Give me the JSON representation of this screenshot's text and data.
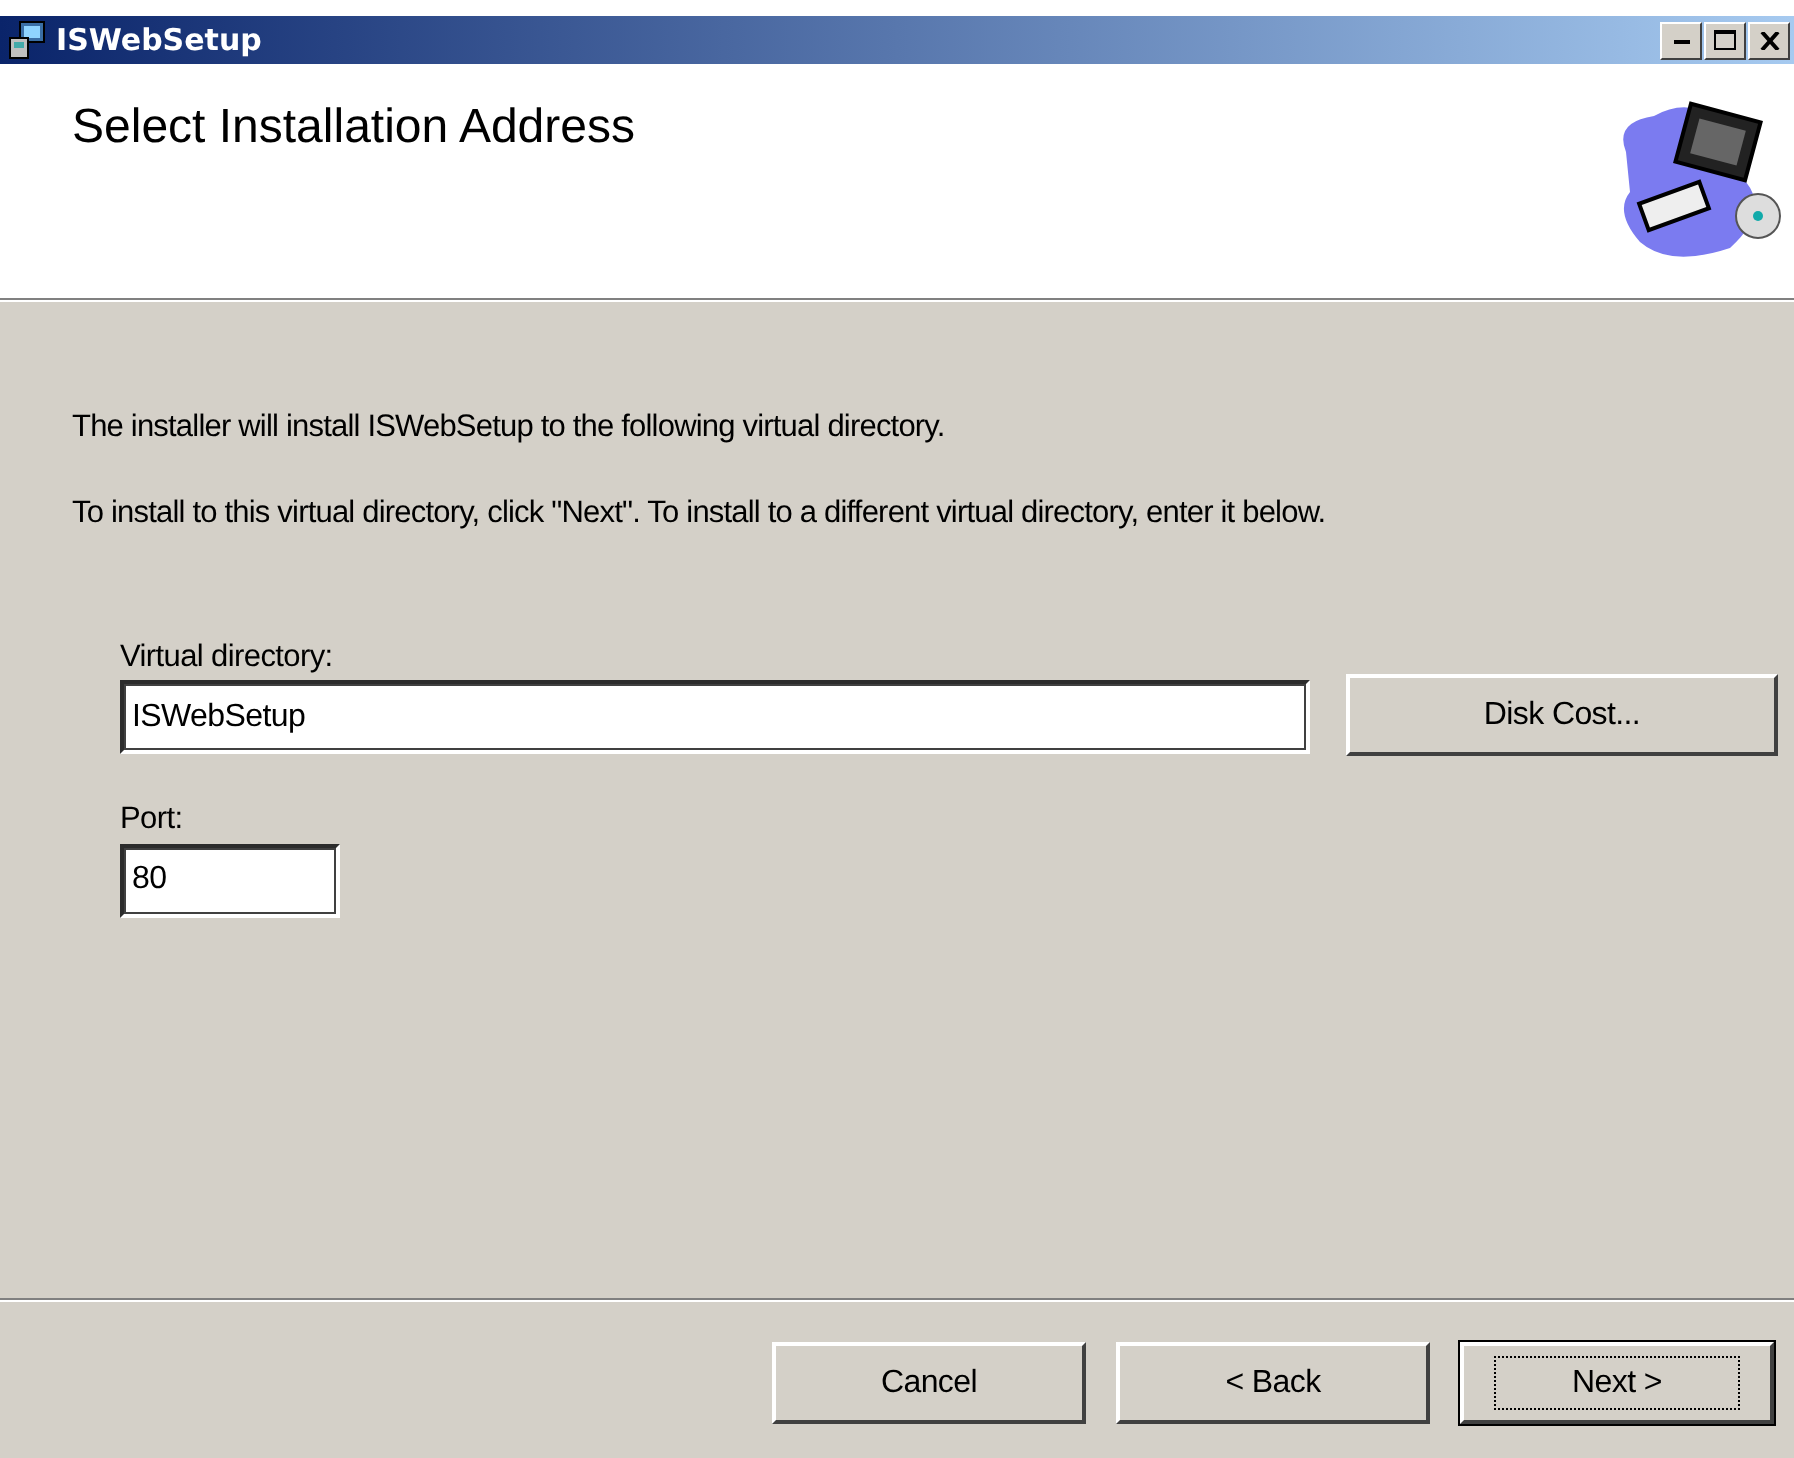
{
  "window": {
    "title": "ISWebSetup"
  },
  "header": {
    "title": "Select Installation Address"
  },
  "paragraphs": [
    "The installer will install ISWebSetup to the following virtual directory.",
    "To install to this virtual directory, click \"Next\". To install to a different virtual directory, enter it below."
  ],
  "fields": [
    {
      "label": "Virtual directory:",
      "value": "ISWebSetup",
      "button": {
        "label": "Disk Cost..."
      }
    },
    {
      "label": "Port:",
      "value": "80"
    }
  ],
  "buttons": [
    {
      "label": "Cancel",
      "default": false
    },
    {
      "label": "< Back",
      "default": false
    },
    {
      "label": "Next >",
      "default": true
    }
  ]
}
